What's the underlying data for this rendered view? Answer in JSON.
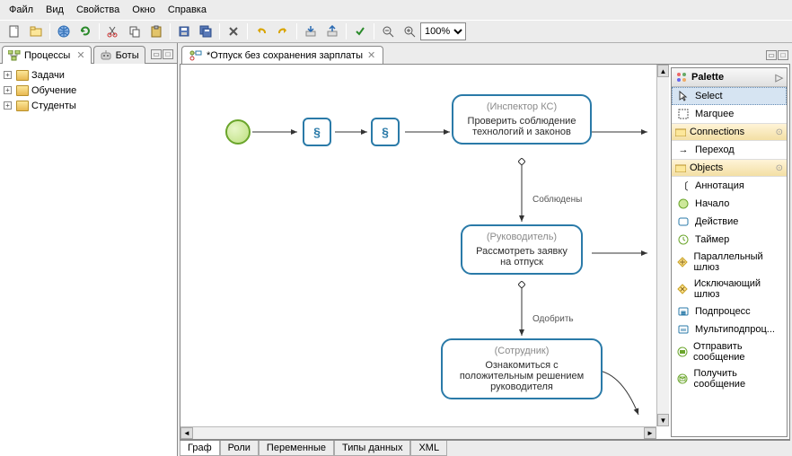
{
  "menu": {
    "items": [
      "Файл",
      "Вид",
      "Свойства",
      "Окно",
      "Справка"
    ]
  },
  "zoom": {
    "value": "100%"
  },
  "sidebar": {
    "tabs": [
      {
        "label": "Процессы",
        "active": true
      },
      {
        "label": "Боты",
        "active": false
      }
    ],
    "tree": [
      {
        "label": "Задачи"
      },
      {
        "label": "Обучение"
      },
      {
        "label": "Студенты"
      }
    ]
  },
  "editor": {
    "tab_label": "*Отпуск без сохранения зарплаты",
    "bottom_tabs": [
      "Граф",
      "Роли",
      "Переменные",
      "Типы данных",
      "XML"
    ],
    "nodes": {
      "n1": {
        "role": "(Инспектор КС)",
        "title": "Проверить соблюдение технологий и законов"
      },
      "n2": {
        "role": "(Руководитель)",
        "title": "Рассмотреть заявку на отпуск"
      },
      "n3": {
        "role": "(Сотрудник)",
        "title": "Ознакомиться с положительным решением руководителя"
      }
    },
    "edges": {
      "e1": "Соблюдены",
      "e2": "Одобрить"
    }
  },
  "palette": {
    "title": "Palette",
    "tools": {
      "select": "Select",
      "marquee": "Marquee"
    },
    "groups": {
      "connections": {
        "title": "Connections",
        "items": [
          {
            "label": "Переход"
          }
        ]
      },
      "objects": {
        "title": "Objects",
        "items": [
          {
            "label": "Аннотация"
          },
          {
            "label": "Начало"
          },
          {
            "label": "Действие"
          },
          {
            "label": "Таймер"
          },
          {
            "label": "Параллельный шлюз"
          },
          {
            "label": "Исключающий шлюз"
          },
          {
            "label": "Подпроцесс"
          },
          {
            "label": "Мультиподпроц..."
          },
          {
            "label": "Отправить сообщение"
          },
          {
            "label": "Получить сообщение"
          }
        ]
      }
    }
  }
}
